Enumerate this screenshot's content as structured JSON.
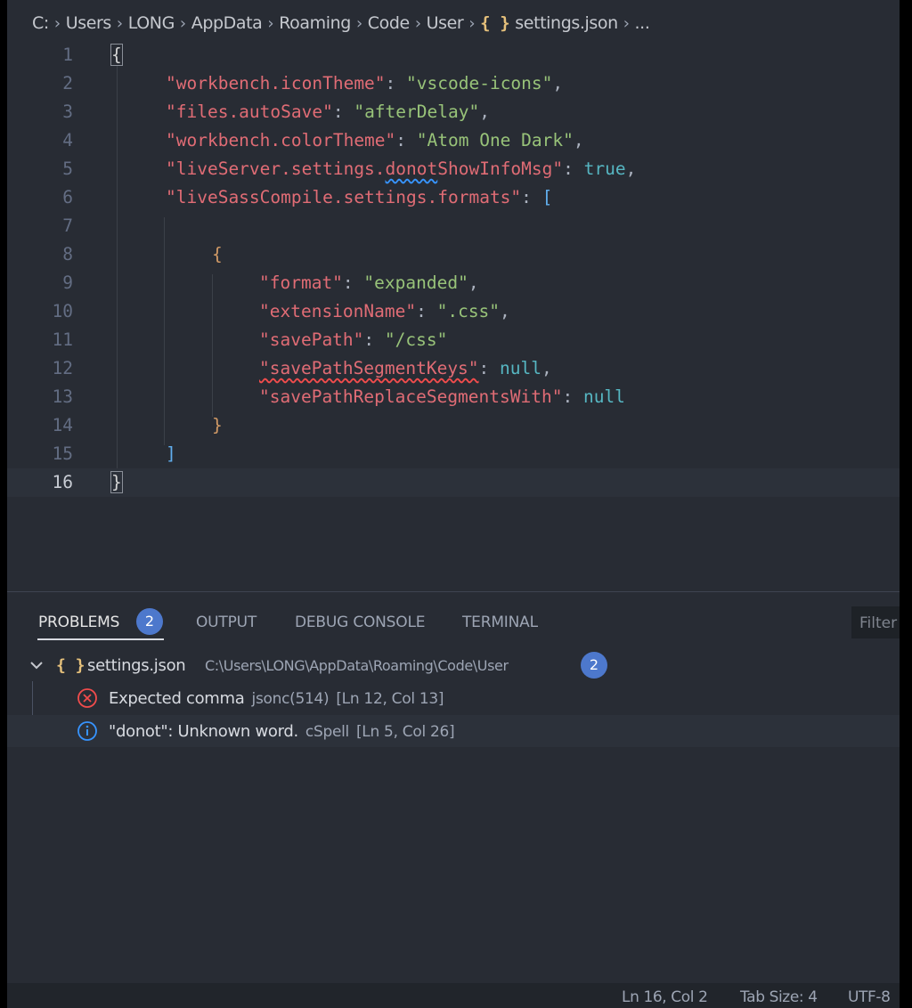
{
  "breadcrumb": {
    "items": [
      "C:",
      "Users",
      "LONG",
      "AppData",
      "Roaming",
      "Code",
      "User"
    ],
    "file_icon": "{ }",
    "file": "settings.json",
    "more": "..."
  },
  "editor": {
    "lines": [
      {
        "n": "1"
      },
      {
        "n": "2"
      },
      {
        "n": "3"
      },
      {
        "n": "4"
      },
      {
        "n": "5"
      },
      {
        "n": "6"
      },
      {
        "n": "7"
      },
      {
        "n": "8"
      },
      {
        "n": "9"
      },
      {
        "n": "10"
      },
      {
        "n": "11"
      },
      {
        "n": "12"
      },
      {
        "n": "13"
      },
      {
        "n": "14"
      },
      {
        "n": "15"
      },
      {
        "n": "16"
      }
    ],
    "tokens": {
      "open_brace": "{",
      "close_brace": "}",
      "k_icon_theme": "\"workbench.iconTheme\"",
      "v_icon_theme": "\"vscode-icons\"",
      "k_auto_save": "\"files.autoSave\"",
      "v_auto_save": "\"afterDelay\"",
      "k_color_theme": "\"workbench.colorTheme\"",
      "v_color_theme": "\"Atom One Dark\"",
      "k_live_server_a": "\"liveServer.settings.",
      "k_live_server_b": "donot",
      "k_live_server_c": "ShowInfoMsg\"",
      "v_live_server": "true",
      "k_formats": "\"liveSassCompile.settings.formats\"",
      "open_bracket": "[",
      "close_bracket": "]",
      "inner_open": "{",
      "inner_close": "}",
      "k_format": "\"format\"",
      "v_format": "\"expanded\"",
      "k_ext": "\"extensionName\"",
      "v_ext": "\".css\"",
      "k_save_path": "\"savePath\"",
      "v_save_path": "\"/css\"",
      "k_seg_keys": "\"savePathSegmentKeys\"",
      "v_seg_keys": "null",
      "k_seg_with": "\"savePathReplaceSegmentsWith\"",
      "v_seg_with": "null",
      "colon": ": ",
      "comma": ","
    }
  },
  "panel": {
    "tabs": [
      {
        "label": "PROBLEMS",
        "active": true
      },
      {
        "label": "OUTPUT"
      },
      {
        "label": "DEBUG CONSOLE"
      },
      {
        "label": "TERMINAL"
      }
    ],
    "problems_count": "2",
    "filter_placeholder": "Filter",
    "file_group": {
      "icon": "{ }",
      "name": "settings.json",
      "path": "C:\\Users\\LONG\\AppData\\Roaming\\Code\\User",
      "count": "2"
    },
    "diagnostics": [
      {
        "severity": "error",
        "message": "Expected comma",
        "source": "jsonc(514)",
        "position": "[Ln 12, Col 13]"
      },
      {
        "severity": "info",
        "message": "\"donot\": Unknown word.",
        "source": "cSpell",
        "position": "[Ln 5, Col 26]"
      }
    ]
  },
  "statusbar": {
    "cursor": "Ln 16, Col 2",
    "tab_size": "Tab Size: 4",
    "encoding": "UTF-8"
  },
  "colors": {
    "editor_bg": "#282c34",
    "key": "#e06c75",
    "string": "#98c379",
    "boolean": "#56b6c2",
    "badge": "#4d78cc",
    "error": "#f14c4c",
    "info": "#3794ff"
  }
}
